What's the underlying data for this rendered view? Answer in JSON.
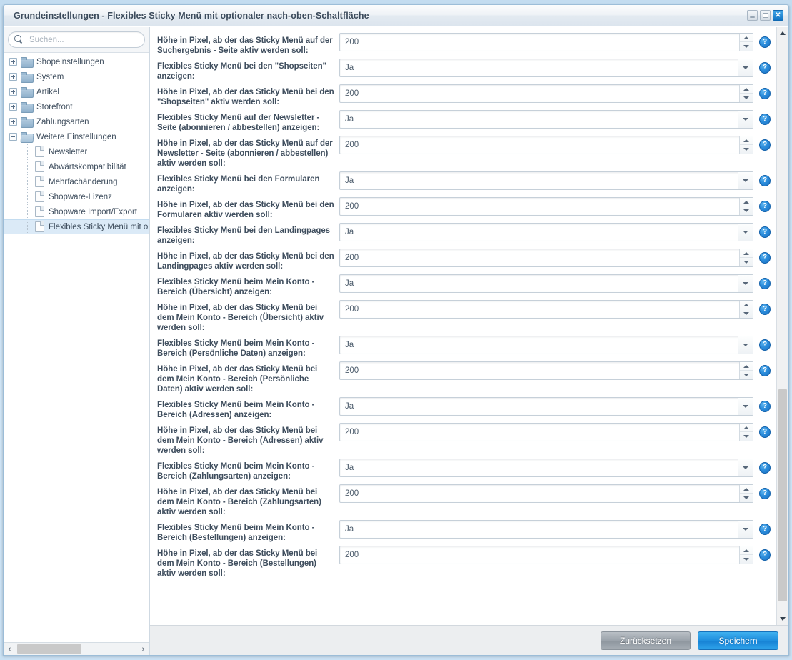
{
  "window": {
    "title": "Grundeinstellungen - Flexibles Sticky Menü mit optionaler nach-oben-Schaltfläche",
    "controls": {
      "minimize": "–",
      "maximize": "□",
      "close": "✕"
    }
  },
  "sidebar": {
    "search": {
      "placeholder": "Suchen...",
      "value": ""
    },
    "tree": [
      {
        "label": "Shopeinstellungen",
        "level": 0,
        "icon": "folder-icon",
        "expanded": false,
        "selected": false
      },
      {
        "label": "System",
        "level": 0,
        "icon": "folder-icon",
        "expanded": false,
        "selected": false
      },
      {
        "label": "Artikel",
        "level": 0,
        "icon": "folder-icon",
        "expanded": false,
        "selected": false
      },
      {
        "label": "Storefront",
        "level": 0,
        "icon": "folder-icon",
        "expanded": false,
        "selected": false
      },
      {
        "label": "Zahlungsarten",
        "level": 0,
        "icon": "folder-icon",
        "expanded": false,
        "selected": false
      },
      {
        "label": "Weitere Einstellungen",
        "level": 0,
        "icon": "folder-open-icon",
        "expanded": true,
        "selected": false
      },
      {
        "label": "Newsletter",
        "level": 1,
        "icon": "page-icon",
        "expanded": null,
        "selected": false
      },
      {
        "label": "Abwärtskompatibilität",
        "level": 1,
        "icon": "page-icon",
        "expanded": null,
        "selected": false
      },
      {
        "label": "Mehrfachänderung",
        "level": 1,
        "icon": "page-icon",
        "expanded": null,
        "selected": false
      },
      {
        "label": "Shopware-Lizenz",
        "level": 1,
        "icon": "page-icon",
        "expanded": null,
        "selected": false
      },
      {
        "label": "Shopware Import/Export",
        "level": 1,
        "icon": "page-icon",
        "expanded": null,
        "selected": false
      },
      {
        "label": "Flexibles Sticky Menü mit option",
        "level": 1,
        "icon": "page-icon",
        "expanded": null,
        "selected": true
      }
    ],
    "hscroll": {
      "left_arrow": "‹",
      "right_arrow": "›"
    }
  },
  "form": {
    "help_glyph": "?",
    "rows": [
      {
        "label": "Höhe in Pixel, ab der das Sticky Menü auf der Suchergebnis - Seite aktiv werden soll:",
        "value": "200",
        "type": "number"
      },
      {
        "label": "Flexibles Sticky Menü bei den \"Shopseiten\" anzeigen:",
        "value": "Ja",
        "type": "select"
      },
      {
        "label": "Höhe in Pixel, ab der das Sticky Menü bei den \"Shopseiten\" aktiv werden soll:",
        "value": "200",
        "type": "number"
      },
      {
        "label": "Flexibles Sticky Menü auf der Newsletter - Seite (abonnieren / abbestellen) anzeigen:",
        "value": "Ja",
        "type": "select"
      },
      {
        "label": "Höhe in Pixel, ab der das Sticky Menü auf der Newsletter - Seite (abonnieren / abbestellen) aktiv werden soll:",
        "value": "200",
        "type": "number"
      },
      {
        "label": "Flexibles Sticky Menü bei den Formularen anzeigen:",
        "value": "Ja",
        "type": "select"
      },
      {
        "label": "Höhe in Pixel, ab der das Sticky Menü bei den Formularen aktiv werden soll:",
        "value": "200",
        "type": "number"
      },
      {
        "label": "Flexibles Sticky Menü bei den Landingpages anzeigen:",
        "value": "Ja",
        "type": "select"
      },
      {
        "label": "Höhe in Pixel, ab der das Sticky Menü bei den Landingpages aktiv werden soll:",
        "value": "200",
        "type": "number"
      },
      {
        "label": "Flexibles Sticky Menü beim Mein Konto - Bereich (Übersicht) anzeigen:",
        "value": "Ja",
        "type": "select"
      },
      {
        "label": "Höhe in Pixel, ab der das Sticky Menü bei dem Mein Konto - Bereich (Übersicht) aktiv werden soll:",
        "value": "200",
        "type": "number"
      },
      {
        "label": "Flexibles Sticky Menü beim Mein Konto - Bereich (Persönliche Daten) anzeigen:",
        "value": "Ja",
        "type": "select"
      },
      {
        "label": "Höhe in Pixel, ab der das Sticky Menü bei dem Mein Konto - Bereich (Persönliche Daten) aktiv werden soll:",
        "value": "200",
        "type": "number"
      },
      {
        "label": "Flexibles Sticky Menü beim Mein Konto - Bereich (Adressen) anzeigen:",
        "value": "Ja",
        "type": "select"
      },
      {
        "label": "Höhe in Pixel, ab der das Sticky Menü bei dem Mein Konto - Bereich (Adressen) aktiv werden soll:",
        "value": "200",
        "type": "number"
      },
      {
        "label": "Flexibles Sticky Menü beim Mein Konto - Bereich (Zahlungsarten) anzeigen:",
        "value": "Ja",
        "type": "select"
      },
      {
        "label": "Höhe in Pixel, ab der das Sticky Menü bei dem Mein Konto - Bereich (Zahlungsarten) aktiv werden soll:",
        "value": "200",
        "type": "number"
      },
      {
        "label": "Flexibles Sticky Menü beim Mein Konto - Bereich (Bestellungen) anzeigen:",
        "value": "Ja",
        "type": "select"
      },
      {
        "label": "Höhe in Pixel, ab der das Sticky Menü bei dem Mein Konto - Bereich (Bestellungen) aktiv werden soll:",
        "value": "200",
        "type": "number"
      }
    ]
  },
  "footer": {
    "reset_label": "Zurücksetzen",
    "save_label": "Speichern"
  },
  "colors": {
    "accent": "#1d8ddd",
    "desktop": "#c6dff2",
    "selection": "#dbeaf7",
    "label_text": "#3f4e5e"
  }
}
